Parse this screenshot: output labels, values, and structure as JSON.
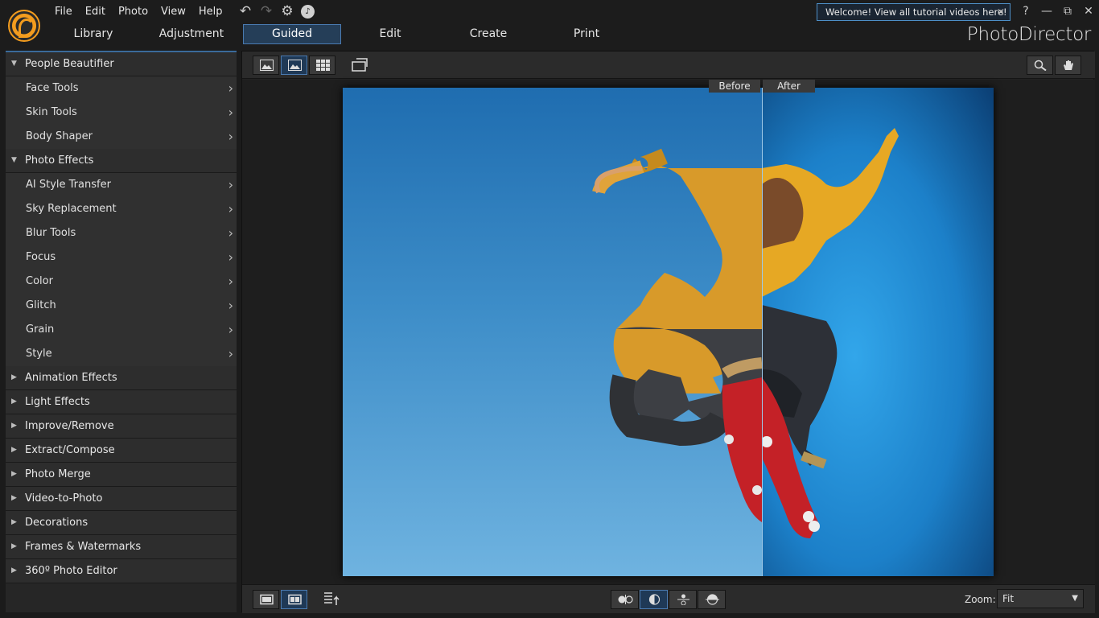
{
  "menu": [
    "File",
    "Edit",
    "Photo",
    "View",
    "Help"
  ],
  "quick_icons": {
    "undo": "↶",
    "redo": "↷",
    "settings": "⚙",
    "notification": "♪"
  },
  "tabs": [
    {
      "label": "Library"
    },
    {
      "label": "Adjustment"
    },
    {
      "label": "Guided",
      "active": true
    },
    {
      "label": "Edit"
    },
    {
      "label": "Create"
    },
    {
      "label": "Print"
    }
  ],
  "brand": "PhotoDirector",
  "notice": {
    "text": "Welcome! View all tutorial videos here!",
    "close": "✕"
  },
  "window_controls": {
    "help": "?",
    "minimize": "—",
    "restore": "⧉",
    "close": "✕"
  },
  "sidebar": {
    "groups": [
      {
        "label": "People Beautifier",
        "expanded": true,
        "items": [
          "Face Tools",
          "Skin Tools",
          "Body Shaper"
        ]
      },
      {
        "label": "Photo Effects",
        "expanded": true,
        "items": [
          "AI Style Transfer",
          "Sky Replacement",
          "Blur Tools",
          "Focus",
          "Color",
          "Glitch",
          "Grain",
          "Style"
        ]
      },
      {
        "label": "Animation Effects",
        "expanded": false,
        "items": []
      },
      {
        "label": "Light Effects",
        "expanded": false,
        "items": []
      },
      {
        "label": "Improve/Remove",
        "expanded": false,
        "items": []
      },
      {
        "label": "Extract/Compose",
        "expanded": false,
        "items": []
      },
      {
        "label": "Photo Merge",
        "expanded": false,
        "items": []
      },
      {
        "label": "Video-to-Photo",
        "expanded": false,
        "items": []
      },
      {
        "label": "Decorations",
        "expanded": false,
        "items": []
      },
      {
        "label": "Frames & Watermarks",
        "expanded": false,
        "items": []
      },
      {
        "label": "360º Photo Editor",
        "expanded": false,
        "items": []
      }
    ],
    "expand_glyph": "▼",
    "collapse_glyph": "▶",
    "chevron_glyph": "›"
  },
  "preview": {
    "before_label": "Before",
    "after_label": "After"
  },
  "zoom": {
    "label": "Zoom:",
    "value": "Fit",
    "arrow": "▼"
  },
  "colors": {
    "accent": "#4a7ab0",
    "active_tab_bg": "#253e58",
    "brand_orange": "#f39c1e"
  }
}
